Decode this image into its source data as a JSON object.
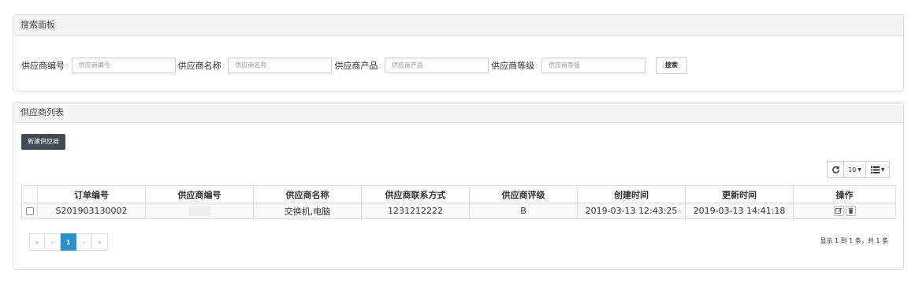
{
  "search_panel": {
    "title": "搜索面板",
    "fields": [
      {
        "label": "供应商编号",
        "colon": ":",
        "placeholder": "供应商编号"
      },
      {
        "label": "供应商名称",
        "colon": ":",
        "placeholder": "供应商名称"
      },
      {
        "label": "供应商产品",
        "colon": ":",
        "placeholder": "供应商产品"
      },
      {
        "label": "供应商等级",
        "colon": ":",
        "placeholder": "供应商等级"
      }
    ],
    "search_button": "搜索"
  },
  "list_panel": {
    "title": "供应商列表",
    "new_button": "新建供应商",
    "toolbar": {
      "refresh_icon": "refresh-icon",
      "page_size": "10",
      "columns_icon": "list-columns-icon"
    },
    "columns": [
      "订单编号",
      "供应商编号",
      "供应商名称",
      "供应商联系方式",
      "供应商评级",
      "创建时间",
      "更新时间",
      "操作"
    ],
    "rows": [
      {
        "order_no": "S201903130002",
        "supplier_no": "",
        "supplier_name": "交换机,电脑",
        "contact": "1231212222",
        "rating": "B",
        "created": "2019-03-13 12:43:25",
        "updated": "2019-03-13 14:41:18",
        "actions": [
          "edit-icon",
          "delete-icon"
        ]
      }
    ],
    "pagination": {
      "first": "«",
      "prev": "‹",
      "current": "1",
      "next": "›",
      "last": "»"
    },
    "page_info": "显示 1 到 1 条，共 1 条"
  }
}
